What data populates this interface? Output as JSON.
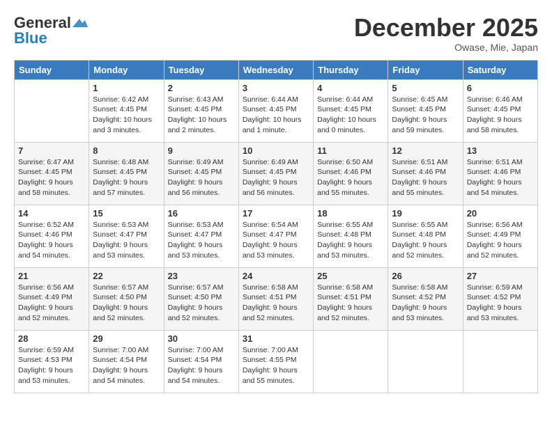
{
  "header": {
    "logo_general": "General",
    "logo_blue": "Blue",
    "month_title": "December 2025",
    "subtitle": "Owase, Mie, Japan"
  },
  "weekdays": [
    "Sunday",
    "Monday",
    "Tuesday",
    "Wednesday",
    "Thursday",
    "Friday",
    "Saturday"
  ],
  "weeks": [
    [
      {
        "day": "",
        "info": ""
      },
      {
        "day": "1",
        "info": "Sunrise: 6:42 AM\nSunset: 4:45 PM\nDaylight: 10 hours\nand 3 minutes."
      },
      {
        "day": "2",
        "info": "Sunrise: 6:43 AM\nSunset: 4:45 PM\nDaylight: 10 hours\nand 2 minutes."
      },
      {
        "day": "3",
        "info": "Sunrise: 6:44 AM\nSunset: 4:45 PM\nDaylight: 10 hours\nand 1 minute."
      },
      {
        "day": "4",
        "info": "Sunrise: 6:44 AM\nSunset: 4:45 PM\nDaylight: 10 hours\nand 0 minutes."
      },
      {
        "day": "5",
        "info": "Sunrise: 6:45 AM\nSunset: 4:45 PM\nDaylight: 9 hours\nand 59 minutes."
      },
      {
        "day": "6",
        "info": "Sunrise: 6:46 AM\nSunset: 4:45 PM\nDaylight: 9 hours\nand 58 minutes."
      }
    ],
    [
      {
        "day": "7",
        "info": "Sunrise: 6:47 AM\nSunset: 4:45 PM\nDaylight: 9 hours\nand 58 minutes."
      },
      {
        "day": "8",
        "info": "Sunrise: 6:48 AM\nSunset: 4:45 PM\nDaylight: 9 hours\nand 57 minutes."
      },
      {
        "day": "9",
        "info": "Sunrise: 6:49 AM\nSunset: 4:45 PM\nDaylight: 9 hours\nand 56 minutes."
      },
      {
        "day": "10",
        "info": "Sunrise: 6:49 AM\nSunset: 4:45 PM\nDaylight: 9 hours\nand 56 minutes."
      },
      {
        "day": "11",
        "info": "Sunrise: 6:50 AM\nSunset: 4:46 PM\nDaylight: 9 hours\nand 55 minutes."
      },
      {
        "day": "12",
        "info": "Sunrise: 6:51 AM\nSunset: 4:46 PM\nDaylight: 9 hours\nand 55 minutes."
      },
      {
        "day": "13",
        "info": "Sunrise: 6:51 AM\nSunset: 4:46 PM\nDaylight: 9 hours\nand 54 minutes."
      }
    ],
    [
      {
        "day": "14",
        "info": "Sunrise: 6:52 AM\nSunset: 4:46 PM\nDaylight: 9 hours\nand 54 minutes."
      },
      {
        "day": "15",
        "info": "Sunrise: 6:53 AM\nSunset: 4:47 PM\nDaylight: 9 hours\nand 53 minutes."
      },
      {
        "day": "16",
        "info": "Sunrise: 6:53 AM\nSunset: 4:47 PM\nDaylight: 9 hours\nand 53 minutes."
      },
      {
        "day": "17",
        "info": "Sunrise: 6:54 AM\nSunset: 4:47 PM\nDaylight: 9 hours\nand 53 minutes."
      },
      {
        "day": "18",
        "info": "Sunrise: 6:55 AM\nSunset: 4:48 PM\nDaylight: 9 hours\nand 53 minutes."
      },
      {
        "day": "19",
        "info": "Sunrise: 6:55 AM\nSunset: 4:48 PM\nDaylight: 9 hours\nand 52 minutes."
      },
      {
        "day": "20",
        "info": "Sunrise: 6:56 AM\nSunset: 4:49 PM\nDaylight: 9 hours\nand 52 minutes."
      }
    ],
    [
      {
        "day": "21",
        "info": "Sunrise: 6:56 AM\nSunset: 4:49 PM\nDaylight: 9 hours\nand 52 minutes."
      },
      {
        "day": "22",
        "info": "Sunrise: 6:57 AM\nSunset: 4:50 PM\nDaylight: 9 hours\nand 52 minutes."
      },
      {
        "day": "23",
        "info": "Sunrise: 6:57 AM\nSunset: 4:50 PM\nDaylight: 9 hours\nand 52 minutes."
      },
      {
        "day": "24",
        "info": "Sunrise: 6:58 AM\nSunset: 4:51 PM\nDaylight: 9 hours\nand 52 minutes."
      },
      {
        "day": "25",
        "info": "Sunrise: 6:58 AM\nSunset: 4:51 PM\nDaylight: 9 hours\nand 52 minutes."
      },
      {
        "day": "26",
        "info": "Sunrise: 6:58 AM\nSunset: 4:52 PM\nDaylight: 9 hours\nand 53 minutes."
      },
      {
        "day": "27",
        "info": "Sunrise: 6:59 AM\nSunset: 4:52 PM\nDaylight: 9 hours\nand 53 minutes."
      }
    ],
    [
      {
        "day": "28",
        "info": "Sunrise: 6:59 AM\nSunset: 4:53 PM\nDaylight: 9 hours\nand 53 minutes."
      },
      {
        "day": "29",
        "info": "Sunrise: 7:00 AM\nSunset: 4:54 PM\nDaylight: 9 hours\nand 54 minutes."
      },
      {
        "day": "30",
        "info": "Sunrise: 7:00 AM\nSunset: 4:54 PM\nDaylight: 9 hours\nand 54 minutes."
      },
      {
        "day": "31",
        "info": "Sunrise: 7:00 AM\nSunset: 4:55 PM\nDaylight: 9 hours\nand 55 minutes."
      },
      {
        "day": "",
        "info": ""
      },
      {
        "day": "",
        "info": ""
      },
      {
        "day": "",
        "info": ""
      }
    ]
  ]
}
